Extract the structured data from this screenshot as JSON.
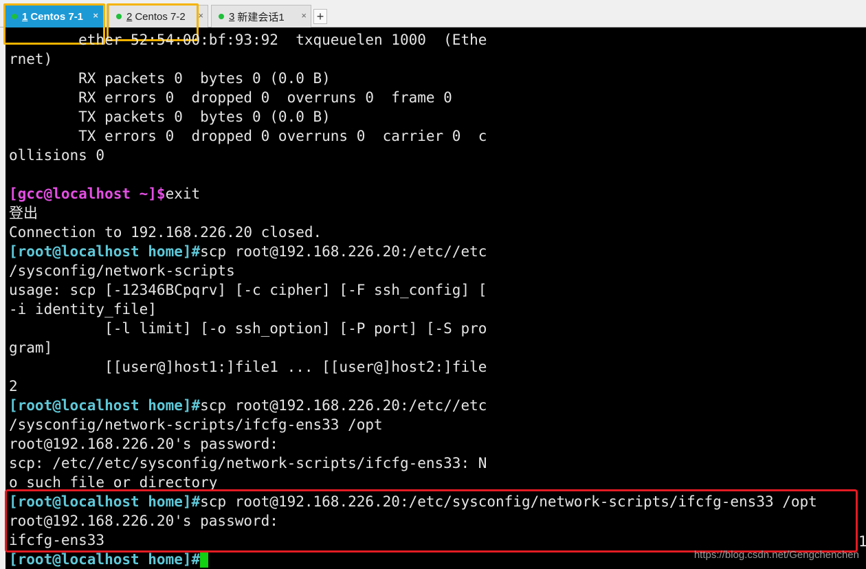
{
  "tabs": [
    {
      "num": "1",
      "label": "Centos 7-1",
      "status_color": "#1fbf3a"
    },
    {
      "num": "2",
      "label": "Centos 7-2",
      "status_color": "#1fbf3a"
    },
    {
      "num": "3",
      "label": "新建会话1",
      "status_color": "#1fbf3a"
    }
  ],
  "new_tab_symbol": "+",
  "close_symbol": "×",
  "colors": {
    "prompt_root": "#5ec8d8",
    "prompt_gcc": "#e44fe4",
    "cursor": "#12d012",
    "highlight_red": "#e31b23",
    "highlight_yellow": "#f5b400"
  },
  "terminal": {
    "lines": [
      {
        "text": "        ether 52:54:00:bf:93:92  txqueuelen 1000  (Ethe"
      },
      {
        "text": "rnet)"
      },
      {
        "text": "        RX packets 0  bytes 0 (0.0 B)"
      },
      {
        "text": "        RX errors 0  dropped 0  overruns 0  frame 0"
      },
      {
        "text": "        TX packets 0  bytes 0 (0.0 B)"
      },
      {
        "text": "        TX errors 0  dropped 0 overruns 0  carrier 0  c"
      },
      {
        "text": "ollisions 0"
      },
      {
        "text": ""
      },
      {
        "prompt": "[gcc@localhost ~]$",
        "text": "exit"
      },
      {
        "text": "登出"
      },
      {
        "text": "Connection to 192.168.226.20 closed."
      },
      {
        "prompt": "[root@localhost home]#",
        "text": "scp root@192.168.226.20:/etc//etc"
      },
      {
        "text": "/sysconfig/network-scripts"
      },
      {
        "text": "usage: scp [-12346BCpqrv] [-c cipher] [-F ssh_config] ["
      },
      {
        "text": "-i identity_file]"
      },
      {
        "text": "           [-l limit] [-o ssh_option] [-P port] [-S pro"
      },
      {
        "text": "gram]"
      },
      {
        "text": "           [[user@]host1:]file1 ... [[user@]host2:]file"
      },
      {
        "text": "2"
      },
      {
        "prompt": "[root@localhost home]#",
        "text": "scp root@192.168.226.20:/etc//etc"
      },
      {
        "text": "/sysconfig/network-scripts/ifcfg-ens33 /opt"
      },
      {
        "text": "root@192.168.226.20's password:"
      },
      {
        "text": "scp: /etc//etc/sysconfig/network-scripts/ifcfg-ens33: N"
      },
      {
        "text": "o such file or directory"
      },
      {
        "prompt": "[root@localhost home]#",
        "text": "scp root@192.168.226.20:/etc/sysconfig/network-scripts/ifcfg-ens33 /opt"
      },
      {
        "text": "root@192.168.226.20's password:"
      },
      {
        "text": "ifcfg-ens33"
      },
      {
        "prompt": "[root@localhost home]#",
        "text": ""
      }
    ],
    "overflow_digit": "1"
  },
  "watermark": "https://blog.csdn.net/Gengchenchen"
}
